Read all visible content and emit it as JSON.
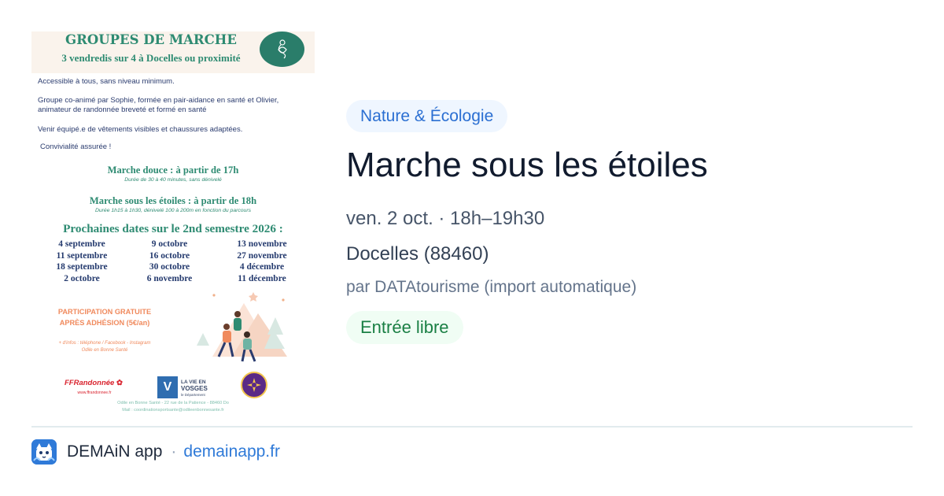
{
  "poster": {
    "title": "GROUPES DE MARCHE",
    "subtitle": "3 vendredis sur 4 à Docelles ou proximité",
    "logo_text": "Odile en Bonne Santé",
    "lines": [
      "Accessible à tous, sans niveau minimum.",
      "Groupe co-animé par Sophie, formée en pair-aidance en santé et Olivier,",
      "animateur de randonnée breveté et formé en santé",
      "Venir équipé.e de vêtements visibles et chaussures adaptées.",
      "Convivialité assurée !"
    ],
    "walk_gentle": "Marche douce : à partir de 17h",
    "walk_gentle_note": "Durée de 30 à 40 minutes, sans dénivelé",
    "walk_stars": "Marche sous les étoiles : à partir de 18h",
    "walk_stars_note": "Durée 1h15 à 1h30, dénivelé 100 à 200m en fonction du parcours",
    "dates_title": "Prochaines dates sur le 2nd semestre 2026 :",
    "dates": [
      "4 septembre",
      "9 octobre",
      "13 novembre",
      "11 septembre",
      "16 octobre",
      "27 novembre",
      "18 septembre",
      "30 octobre",
      "4 décembre",
      "2 octobre",
      "6 novembre",
      "11 décembre"
    ],
    "participation_1": "PARTICIPATION GRATUITE",
    "participation_2": "APRÈS ADHÉSION (5€/an)",
    "info_1": "+ d'infos : téléphone / Facebook - Instagram",
    "info_2": "Odile en Bonne Santé",
    "partner_ffr": "FFRandonnée",
    "partner_ffr_url": "www.ffrandonnee.fr",
    "partner_vosges_1": "LA VIE EN",
    "partner_vosges_2": "VOSGES",
    "partner_vosges_3": "le Département",
    "footer_1": "Odile en Bonne Santé - 22 rue de la Patience - 88460 Do",
    "footer_2": "Mail : coordinationsportsante@odileenbonnesante.fr"
  },
  "event": {
    "category": "Nature & Écologie",
    "title": "Marche sous les étoiles",
    "when": "ven. 2 oct. · 18h–19h30",
    "where": "Docelles (88460)",
    "by": "par DATAtourisme (import automatique)",
    "price": "Entrée libre"
  },
  "footer": {
    "app_name": "DEMAiN app",
    "separator": "·",
    "url": "demainapp.fr"
  },
  "colors": {
    "accent_blue": "#2b6fd2",
    "category_bg": "#eff6ff",
    "price_green": "#1a7f44",
    "price_bg": "#f0fdf4",
    "poster_green": "#2e8b72",
    "poster_orange": "#f08a5d"
  },
  "icons": {
    "app": "demain-app-icon",
    "poster_logo": "odile-logo-icon"
  }
}
